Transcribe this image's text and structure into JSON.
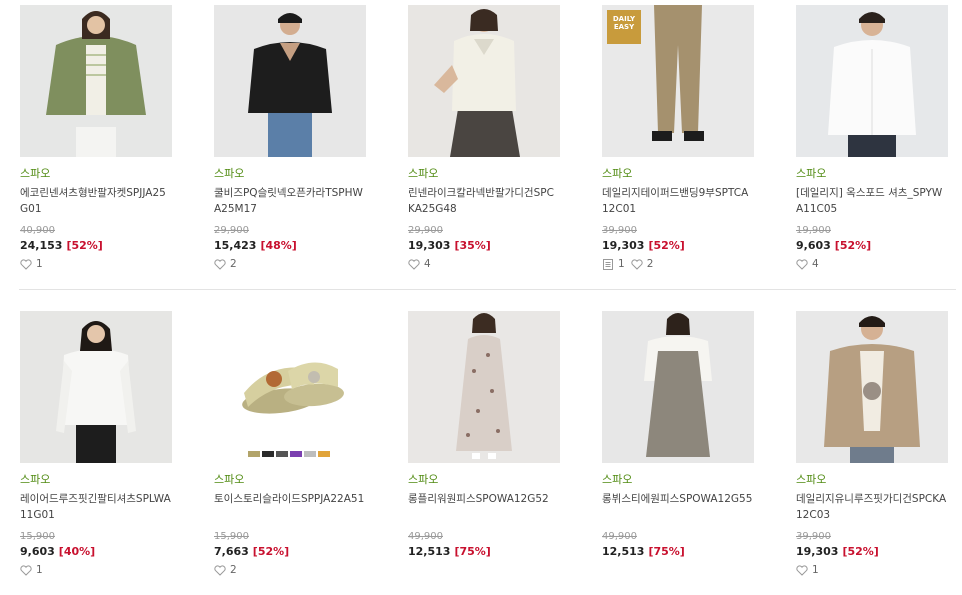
{
  "rows": [
    [
      {
        "brand": "스파오",
        "name": "에코린넨셔츠형반팔자켓SPJJA25G01",
        "orig": "40,900",
        "price": "24,153",
        "discount": "[52%]",
        "reviews": null,
        "likes": "1"
      },
      {
        "brand": "스파오",
        "name": "쿨비즈PQ슬릿넥오픈카라TSPHWA25M17",
        "orig": "29,900",
        "price": "15,423",
        "discount": "[48%]",
        "reviews": null,
        "likes": "2"
      },
      {
        "brand": "스파오",
        "name": "린넨라이크칼라넥반팔가디건SPCKA25G48",
        "orig": "29,900",
        "price": "19,303",
        "discount": "[35%]",
        "reviews": null,
        "likes": "4"
      },
      {
        "brand": "스파오",
        "name": "데일리지테이퍼드밴딩9부SPTCA12C01",
        "orig": "39,900",
        "price": "19,303",
        "discount": "[52%]",
        "reviews": "1",
        "likes": "2",
        "badge": "DAILY EASY"
      },
      {
        "brand": "스파오",
        "name": "[데일리지] 옥스포드 셔츠_SPYWA11C05",
        "orig": "19,900",
        "price": "9,603",
        "discount": "[52%]",
        "reviews": null,
        "likes": "4"
      }
    ],
    [
      {
        "brand": "스파오",
        "name": "레이어드루즈핏긴팔티셔츠SPLWA11G01",
        "orig": "15,900",
        "price": "9,603",
        "discount": "[40%]",
        "reviews": null,
        "likes": "1"
      },
      {
        "brand": "스파오",
        "name": "토이스토리슬라이드SPPJA22A51",
        "orig": "15,900",
        "price": "7,663",
        "discount": "[52%]",
        "reviews": null,
        "likes": "2"
      },
      {
        "brand": "스파오",
        "name": "롱플리워원피스SPOWA12G52",
        "orig": "49,900",
        "price": "12,513",
        "discount": "[75%]",
        "reviews": null,
        "likes": null
      },
      {
        "brand": "스파오",
        "name": "롱뷔스티에원피스SPOWA12G55",
        "orig": "49,900",
        "price": "12,513",
        "discount": "[75%]",
        "reviews": null,
        "likes": null
      },
      {
        "brand": "스파오",
        "name": "데일리지유니루즈핏가디건SPCKA12C03",
        "orig": "39,900",
        "price": "19,303",
        "discount": "[52%]",
        "reviews": null,
        "likes": "1"
      }
    ]
  ],
  "colors": {
    "brand": "#4f8a10",
    "discount": "#c8102e",
    "divider": "#e3e3e3"
  },
  "icons": {
    "like": "heart-outline-icon",
    "review": "review-note-icon"
  }
}
